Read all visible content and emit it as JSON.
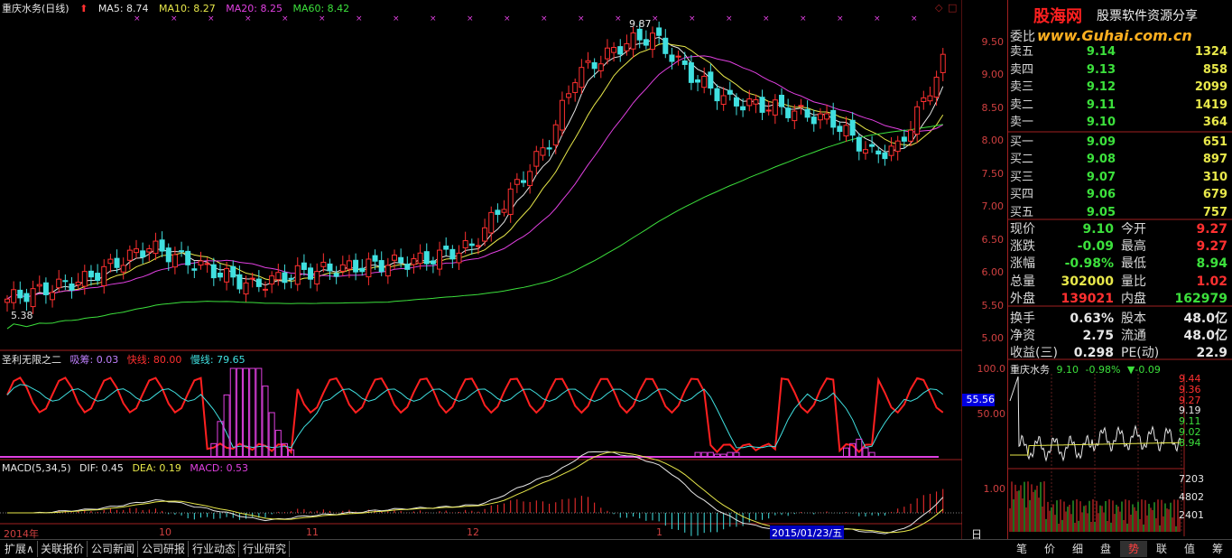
{
  "header": {
    "title": "重庆水务(日线)",
    "ma5": "MA5: 8.74",
    "ma10": "MA10: 8.27",
    "ma20": "MA20: 8.25",
    "ma60": "MA60: 8.42"
  },
  "price_axis": [
    "9.50",
    "9.00",
    "8.50",
    "8.00",
    "7.50",
    "7.00",
    "6.50",
    "6.00",
    "5.50",
    "5.00"
  ],
  "annotations": {
    "high": "9.87",
    "low": "5.38"
  },
  "indicator1": {
    "name": "圣利无限之二",
    "absorb": "吸筹: 0.03",
    "fast": "快线: 80.00",
    "slow": "慢线: 79.65",
    "axis": [
      "100.0",
      "50.00"
    ],
    "marker": "55.56"
  },
  "indicator2": {
    "name": "MACD(5,34,5)",
    "dif": "DIF: 0.45",
    "dea": "DEA: 0.19",
    "macd": "MACD: 0.53",
    "axis": "1.00"
  },
  "time_axis": {
    "labels": [
      "2014年",
      "10",
      "11",
      "12",
      "1"
    ],
    "cursor": "2015/01/23/五",
    "period": "日线"
  },
  "logo": {
    "brand": "股海网",
    "slogan": "股票软件资源分享",
    "url": "www.Guhai.com.cn"
  },
  "order_book": {
    "committee": "委比",
    "rows": [
      {
        "label": "卖五",
        "price": "9.14",
        "vol": "1324"
      },
      {
        "label": "卖四",
        "price": "9.13",
        "vol": "858"
      },
      {
        "label": "卖三",
        "price": "9.12",
        "vol": "2099"
      },
      {
        "label": "卖二",
        "price": "9.11",
        "vol": "1419"
      },
      {
        "label": "卖一",
        "price": "9.10",
        "vol": "364"
      },
      {
        "label": "买一",
        "price": "9.09",
        "vol": "651"
      },
      {
        "label": "买二",
        "price": "9.08",
        "vol": "897"
      },
      {
        "label": "买三",
        "price": "9.07",
        "vol": "310"
      },
      {
        "label": "买四",
        "price": "9.06",
        "vol": "679"
      },
      {
        "label": "买五",
        "price": "9.05",
        "vol": "757"
      }
    ]
  },
  "stats": [
    {
      "l1": "现价",
      "v1": "9.10",
      "c1": "#3ce03c",
      "l2": "今开",
      "v2": "9.27",
      "c2": "#ff3030"
    },
    {
      "l1": "涨跌",
      "v1": "-0.09",
      "c1": "#3ce03c",
      "l2": "最高",
      "v2": "9.27",
      "c2": "#ff3030"
    },
    {
      "l1": "涨幅",
      "v1": "-0.98%",
      "c1": "#3ce03c",
      "l2": "最低",
      "v2": "8.94",
      "c2": "#3ce03c"
    },
    {
      "l1": "总量",
      "v1": "302000",
      "c1": "#e8e84a",
      "l2": "量比",
      "v2": "1.02",
      "c2": "#ff3030"
    },
    {
      "l1": "外盘",
      "v1": "139021",
      "c1": "#ff3030",
      "l2": "内盘",
      "v2": "162979",
      "c2": "#3ce03c"
    },
    {
      "l1": "换手",
      "v1": "0.63%",
      "c1": "#e6e6e6",
      "l2": "股本",
      "v2": "48.0亿",
      "c2": "#e6e6e6"
    },
    {
      "l1": "净资",
      "v1": "2.75",
      "c1": "#e6e6e6",
      "l2": "流通",
      "v2": "48.0亿",
      "c2": "#e6e6e6"
    },
    {
      "l1": "收益(三)",
      "v1": "0.298",
      "c1": "#e6e6e6",
      "l2": "PE(动)",
      "v2": "22.9",
      "c2": "#e6e6e6"
    }
  ],
  "mini": {
    "name": "重庆水务",
    "price": "9.10",
    "pct": "-0.98%",
    "chg": "▼-0.09",
    "price_axis": [
      "9.44",
      "9.36",
      "9.27",
      "9.19",
      "9.11",
      "9.02",
      "8.94"
    ],
    "vol_axis": [
      "7203",
      "4802",
      "2401"
    ]
  },
  "bottom_tabs": [
    "扩展∧",
    "关联报价",
    "公司新闻",
    "公司研报",
    "行业动态",
    "行业研究"
  ],
  "right_tabs": [
    "笔",
    "价",
    "细",
    "盘",
    "势",
    "联",
    "值",
    "筹"
  ],
  "active_right_tab": "势",
  "colors": {
    "up": "#ff3030",
    "down": "#40e0e0",
    "ma5": "#e6e6e6",
    "ma10": "#e8e84a",
    "ma20": "#e040e0",
    "ma60": "#3ce03c",
    "grid": "#a02020"
  }
}
